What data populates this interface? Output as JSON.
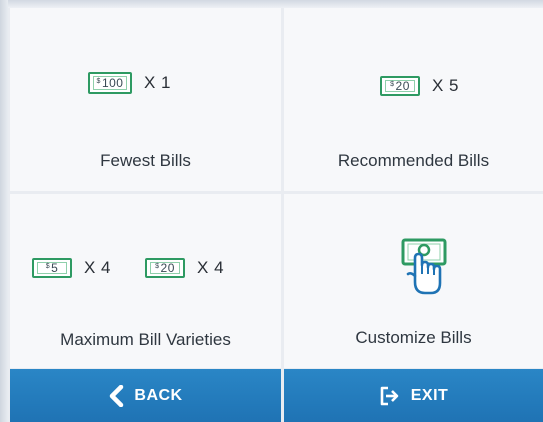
{
  "options": [
    {
      "bills": [
        {
          "value": "100",
          "qty": "X 1"
        }
      ],
      "label": "Fewest Bills"
    },
    {
      "bills": [
        {
          "value": "20",
          "qty": "X 5"
        }
      ],
      "label": "Recommended Bills"
    },
    {
      "bills": [
        {
          "value": "5",
          "qty": "X 4"
        },
        {
          "value": "20",
          "qty": "X 4"
        }
      ],
      "label": "Maximum Bill Varieties"
    },
    {
      "icon": "hand-tap-cash-icon",
      "label": "Customize Bills"
    }
  ],
  "currency_symbol": "$",
  "nav": {
    "back_label": "BACK",
    "back_icon": "chevron-left-icon",
    "exit_label": "EXIT",
    "exit_icon": "exit-door-icon"
  },
  "colors": {
    "accent": "#2279bb",
    "bill_green": "#2e9a62",
    "tile": "#f7f8fa"
  }
}
